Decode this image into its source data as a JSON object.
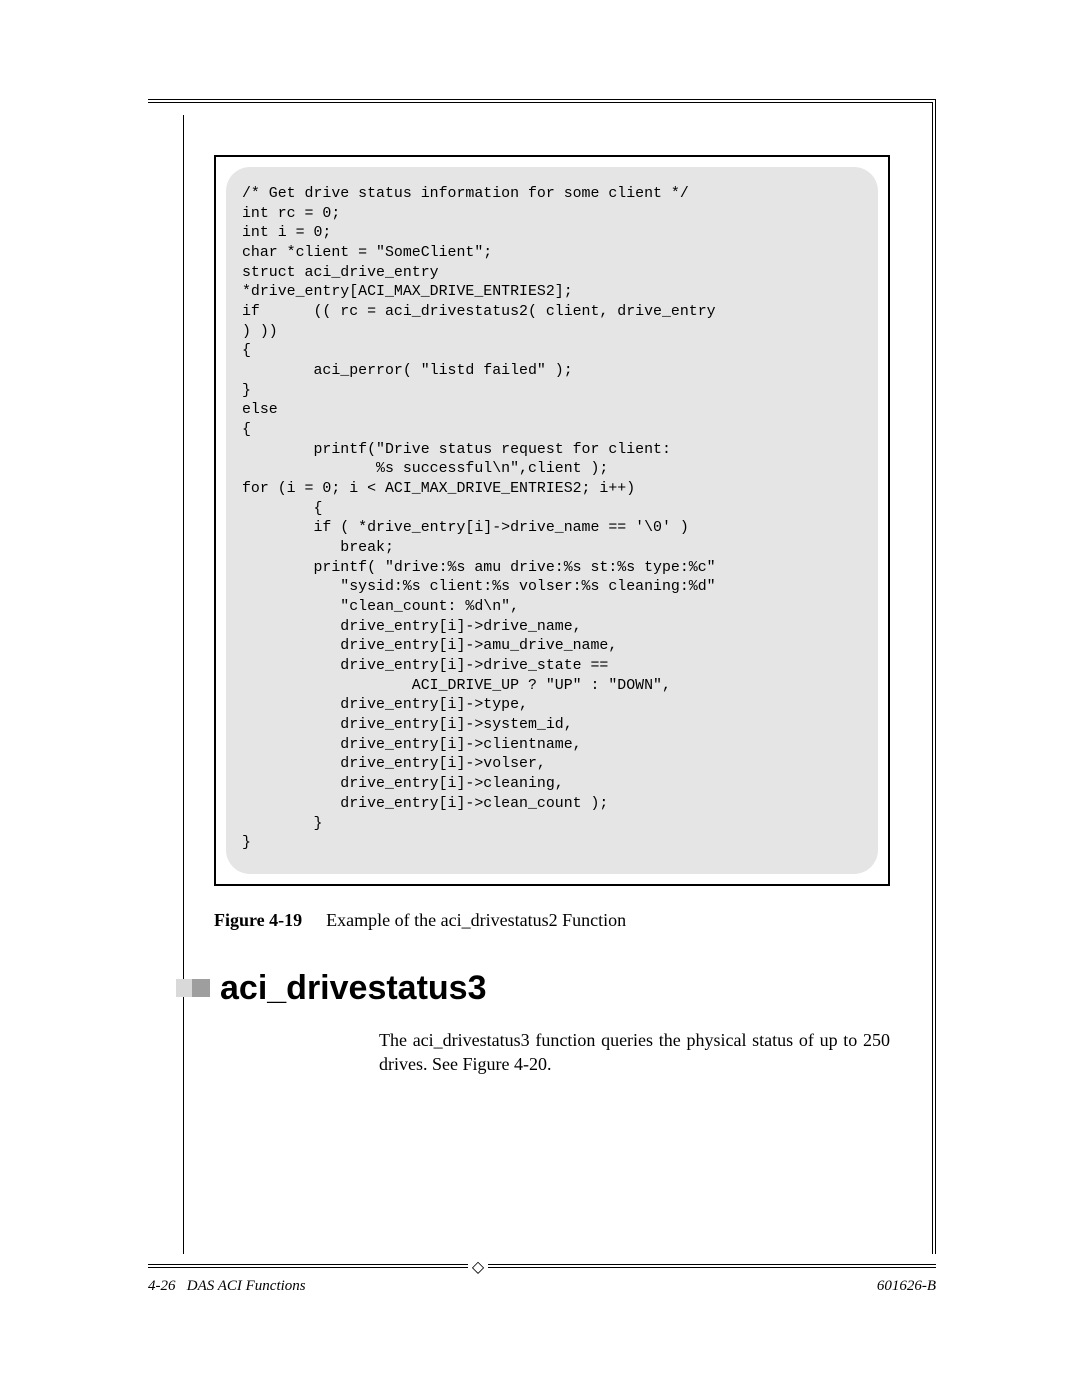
{
  "code": "/* Get drive status information for some client */\nint rc = 0;\nint i = 0;\nchar *client = \"SomeClient\";\nstruct aci_drive_entry\n*drive_entry[ACI_MAX_DRIVE_ENTRIES2];\nif      (( rc = aci_drivestatus2( client, drive_entry\n) ))\n{\n        aci_perror( \"listd failed\" );\n}\nelse\n{\n        printf(\"Drive status request for client:\n               %s successful\\n\",client );\nfor (i = 0; i < ACI_MAX_DRIVE_ENTRIES2; i++)\n        {\n        if ( *drive_entry[i]->drive_name == '\\0' )\n           break;\n        printf( \"drive:%s amu drive:%s st:%s type:%c\"\n           \"sysid:%s client:%s volser:%s cleaning:%d\"\n           \"clean_count: %d\\n\",\n           drive_entry[i]->drive_name,\n           drive_entry[i]->amu_drive_name,\n           drive_entry[i]->drive_state ==\n                   ACI_DRIVE_UP ? \"UP\" : \"DOWN\",\n           drive_entry[i]->type,\n           drive_entry[i]->system_id,\n           drive_entry[i]->clientname,\n           drive_entry[i]->volser,\n           drive_entry[i]->cleaning,\n           drive_entry[i]->clean_count );\n        }\n}",
  "caption": {
    "label": "Figure 4-19",
    "text": "Example of the aci_drivestatus2 Function"
  },
  "section": {
    "title": "aci_drivestatus3",
    "body": "The aci_drivestatus3 function queries the physical status of up to 250 drives. See Figure 4-20."
  },
  "footer": {
    "left_page": "4-26",
    "left_title": "DAS ACI Functions",
    "right": "601626-B"
  }
}
